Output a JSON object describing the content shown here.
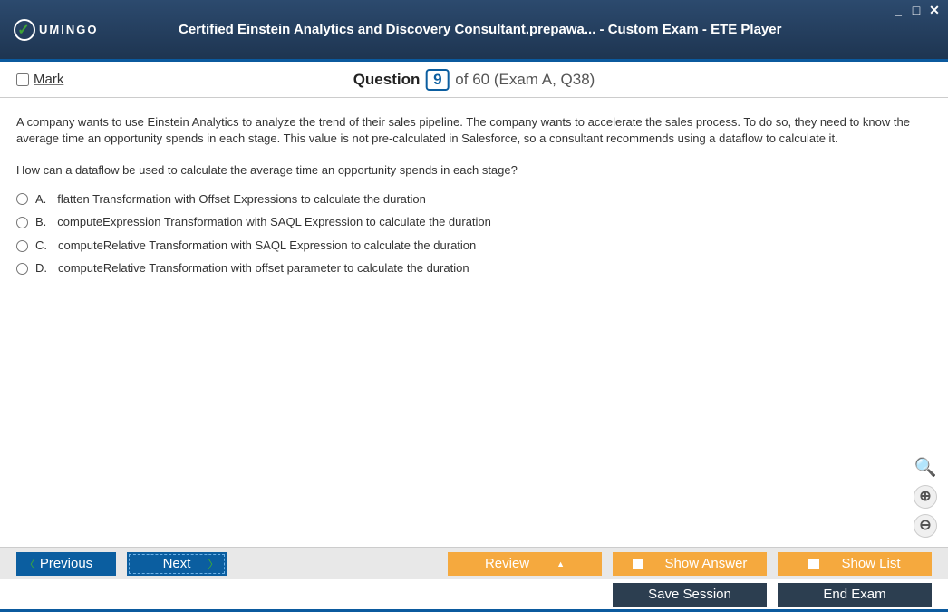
{
  "window": {
    "title": "Certified Einstein Analytics and Discovery Consultant.prepawa... - Custom Exam - ETE Player",
    "logo_text": "UMINGO"
  },
  "questionBar": {
    "mark_label": "Mark",
    "q_label": "Question",
    "q_num": "9",
    "q_suffix": "of 60 (Exam A, Q38)"
  },
  "question": {
    "body": "A company wants to use Einstein Analytics to analyze the trend of their sales pipeline. The company wants to accelerate the sales process. To do so, they need to know the average time an opportunity spends in each stage. This value is not pre-calculated in Salesforce, so a consultant recommends using a dataflow to calculate it.",
    "prompt": "How can a dataflow be used to calculate the average time an opportunity spends in each stage?",
    "options": [
      {
        "letter": "A.",
        "text": "flatten Transformation with Offset Expressions to calculate the duration"
      },
      {
        "letter": "B.",
        "text": "computeExpression Transformation with SAQL Expression to calculate the duration"
      },
      {
        "letter": "C.",
        "text": "computeRelative Transformation with SAQL Expression to calculate the duration"
      },
      {
        "letter": "D.",
        "text": "computeRelative Transformation with offset parameter to calculate the duration"
      }
    ]
  },
  "buttons": {
    "previous": "Previous",
    "next": "Next",
    "review": "Review",
    "show_answer": "Show Answer",
    "show_list": "Show List",
    "save_session": "Save Session",
    "end_exam": "End Exam"
  }
}
